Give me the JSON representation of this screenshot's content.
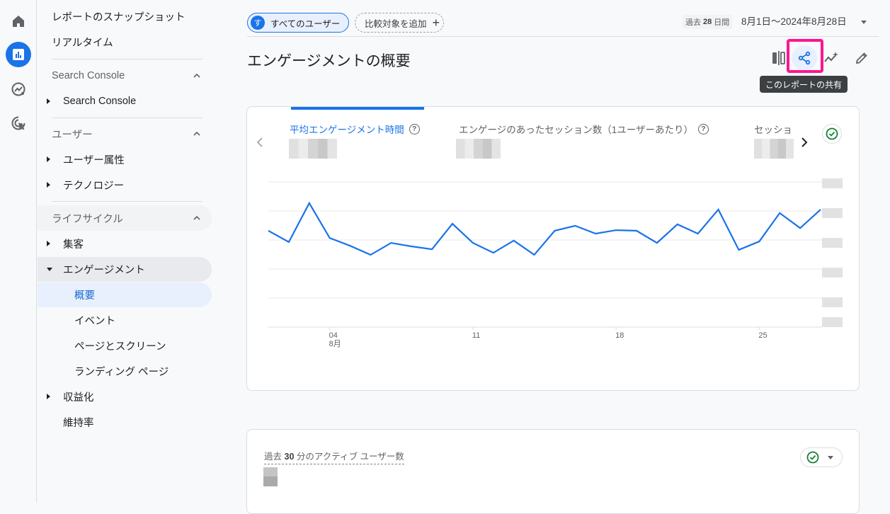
{
  "rail": {
    "items": [
      {
        "icon": "home-icon",
        "active": false
      },
      {
        "icon": "reports-bar-chart-icon",
        "active": true
      },
      {
        "icon": "explore-trend-icon",
        "active": false
      },
      {
        "icon": "advertising-target-icon",
        "active": false
      }
    ]
  },
  "nav": {
    "top_items": [
      "レポートのスナップショット",
      "リアルタイム"
    ],
    "sections": [
      {
        "title": "Search Console",
        "items": [
          {
            "label": "Search Console",
            "expandable": true
          }
        ]
      },
      {
        "title": "ユーザー",
        "items": [
          {
            "label": "ユーザー属性",
            "expandable": true
          },
          {
            "label": "テクノロジー",
            "expandable": true
          }
        ]
      },
      {
        "title": "ライフサイクル",
        "items": [
          {
            "label": "集客",
            "expandable": true
          },
          {
            "label": "エンゲージメント",
            "expandable": true,
            "expanded": true,
            "children": [
              "概要",
              "イベント",
              "ページとスクリーン",
              "ランディング ページ"
            ],
            "selected_child": "概要"
          },
          {
            "label": "収益化",
            "expandable": true
          },
          {
            "label": "維持率",
            "expandable": false
          }
        ]
      }
    ]
  },
  "header": {
    "segment_chip": {
      "avatar": "す",
      "label": "すべてのユーザー"
    },
    "compare_chip": {
      "label": "比較対象を追加",
      "icon": "plus-icon"
    },
    "date_tag_prefix": "過去",
    "date_tag_days": "28",
    "date_tag_suffix": "日間",
    "date_range": "8月1日～2024年8月28日",
    "page_title": "エンゲージメントの概要",
    "tools": [
      "compare-icon",
      "share-icon",
      "insights-icon",
      "edit-icon"
    ],
    "tooltip": "このレポートの共有"
  },
  "accent_color": "#1a73e8",
  "highlight_color": "#ff1493",
  "metrics_card": {
    "tabs": [
      {
        "label": "平均エンゲージメント時間",
        "active": true,
        "value_hidden": true
      },
      {
        "label": "エンゲージのあったセッション数（1ユーザーあたり）",
        "active": false,
        "value_hidden": true
      },
      {
        "label": "セッショ",
        "active": false,
        "value_hidden": true
      }
    ]
  },
  "chart_data": {
    "type": "line",
    "title": "平均エンゲージメント時間",
    "xlabel": "",
    "ylabel": "",
    "y_tick_labels_hidden": true,
    "y_units_note": "values normalized to gridline units (axis labels obscured)",
    "ylim": [
      0,
      5
    ],
    "grid": true,
    "x": [
      1,
      2,
      3,
      4,
      5,
      6,
      7,
      8,
      9,
      10,
      11,
      12,
      13,
      14,
      15,
      16,
      17,
      18,
      19,
      20,
      21,
      22,
      23,
      24,
      25,
      26,
      27,
      28
    ],
    "x_ticks": [
      {
        "day": 4,
        "label": "04",
        "sublabel": "8月"
      },
      {
        "day": 11,
        "label": "11"
      },
      {
        "day": 18,
        "label": "18"
      },
      {
        "day": 25,
        "label": "25"
      }
    ],
    "series": [
      {
        "name": "平均エンゲージメント時間",
        "color": "#1a73e8",
        "values": [
          3.32,
          2.93,
          4.27,
          3.07,
          2.8,
          2.49,
          2.9,
          2.78,
          2.68,
          3.56,
          2.9,
          2.56,
          2.98,
          2.49,
          3.32,
          3.49,
          3.22,
          3.34,
          3.32,
          2.9,
          3.54,
          3.22,
          4.05,
          2.66,
          2.95,
          3.93,
          3.41,
          4.05
        ]
      }
    ]
  },
  "realtime_card": {
    "title_prefix": "過去",
    "title_num": "30",
    "title_suffix": "分のアクティブ ユーザー数",
    "value_hidden": true
  }
}
